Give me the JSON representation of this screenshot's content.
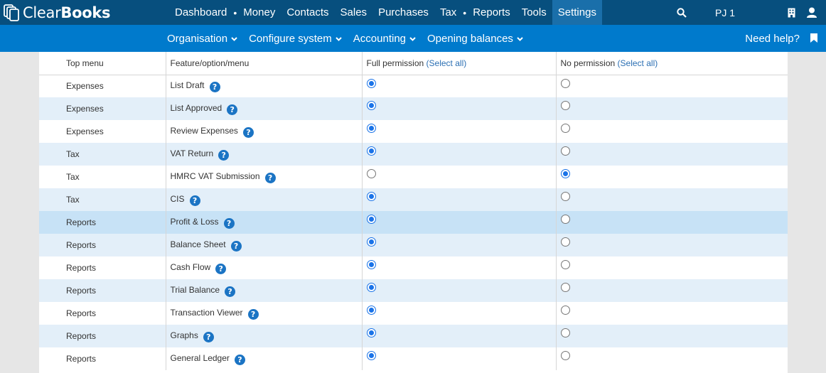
{
  "brand": {
    "name_light": "Clear",
    "name_bold": "Books"
  },
  "main_nav": [
    {
      "label": "Dashboard",
      "dot_after": true,
      "active": false
    },
    {
      "label": "Money",
      "dot_after": false,
      "active": false
    },
    {
      "label": "Contacts",
      "dot_after": false,
      "active": false
    },
    {
      "label": "Sales",
      "dot_after": false,
      "active": false
    },
    {
      "label": "Purchases",
      "dot_after": false,
      "active": false
    },
    {
      "label": "Tax",
      "dot_after": true,
      "active": false
    },
    {
      "label": "Reports",
      "dot_after": false,
      "active": false
    },
    {
      "label": "Tools",
      "dot_after": false,
      "active": false
    },
    {
      "label": "Settings",
      "dot_after": false,
      "active": true
    }
  ],
  "user": {
    "label": "PJ 1"
  },
  "sub_nav": [
    "Organisation",
    "Configure system",
    "Accounting",
    "Opening balances"
  ],
  "help_label": "Need help?",
  "table": {
    "headers": {
      "top_menu": "Top menu",
      "feature": "Feature/option/menu",
      "full": "Full permission",
      "none": "No permission",
      "select_all": "(Select all)"
    },
    "rows": [
      {
        "menu": "Expenses",
        "feature": "List Draft",
        "permission": "full"
      },
      {
        "menu": "Expenses",
        "feature": "List Approved",
        "permission": "full"
      },
      {
        "menu": "Expenses",
        "feature": "Review Expenses",
        "permission": "full"
      },
      {
        "menu": "Tax",
        "feature": "VAT Return",
        "permission": "full"
      },
      {
        "menu": "Tax",
        "feature": "HMRC VAT Submission",
        "permission": "none"
      },
      {
        "menu": "Tax",
        "feature": "CIS",
        "permission": "full"
      },
      {
        "menu": "Reports",
        "feature": "Profit & Loss",
        "permission": "full"
      },
      {
        "menu": "Reports",
        "feature": "Balance Sheet",
        "permission": "full"
      },
      {
        "menu": "Reports",
        "feature": "Cash Flow",
        "permission": "full"
      },
      {
        "menu": "Reports",
        "feature": "Trial Balance",
        "permission": "full"
      },
      {
        "menu": "Reports",
        "feature": "Transaction Viewer",
        "permission": "full"
      },
      {
        "menu": "Reports",
        "feature": "Graphs",
        "permission": "full"
      },
      {
        "menu": "Reports",
        "feature": "General Ledger",
        "permission": "full"
      }
    ],
    "highlighted_row": 6
  },
  "colors": {
    "topbar": "#074f7e",
    "subbar": "#007acc",
    "active_tab": "#1a6faa",
    "row_alt": "#e3eff9",
    "row_hover": "#c7e2f6",
    "help_icon": "#1b74c4"
  }
}
